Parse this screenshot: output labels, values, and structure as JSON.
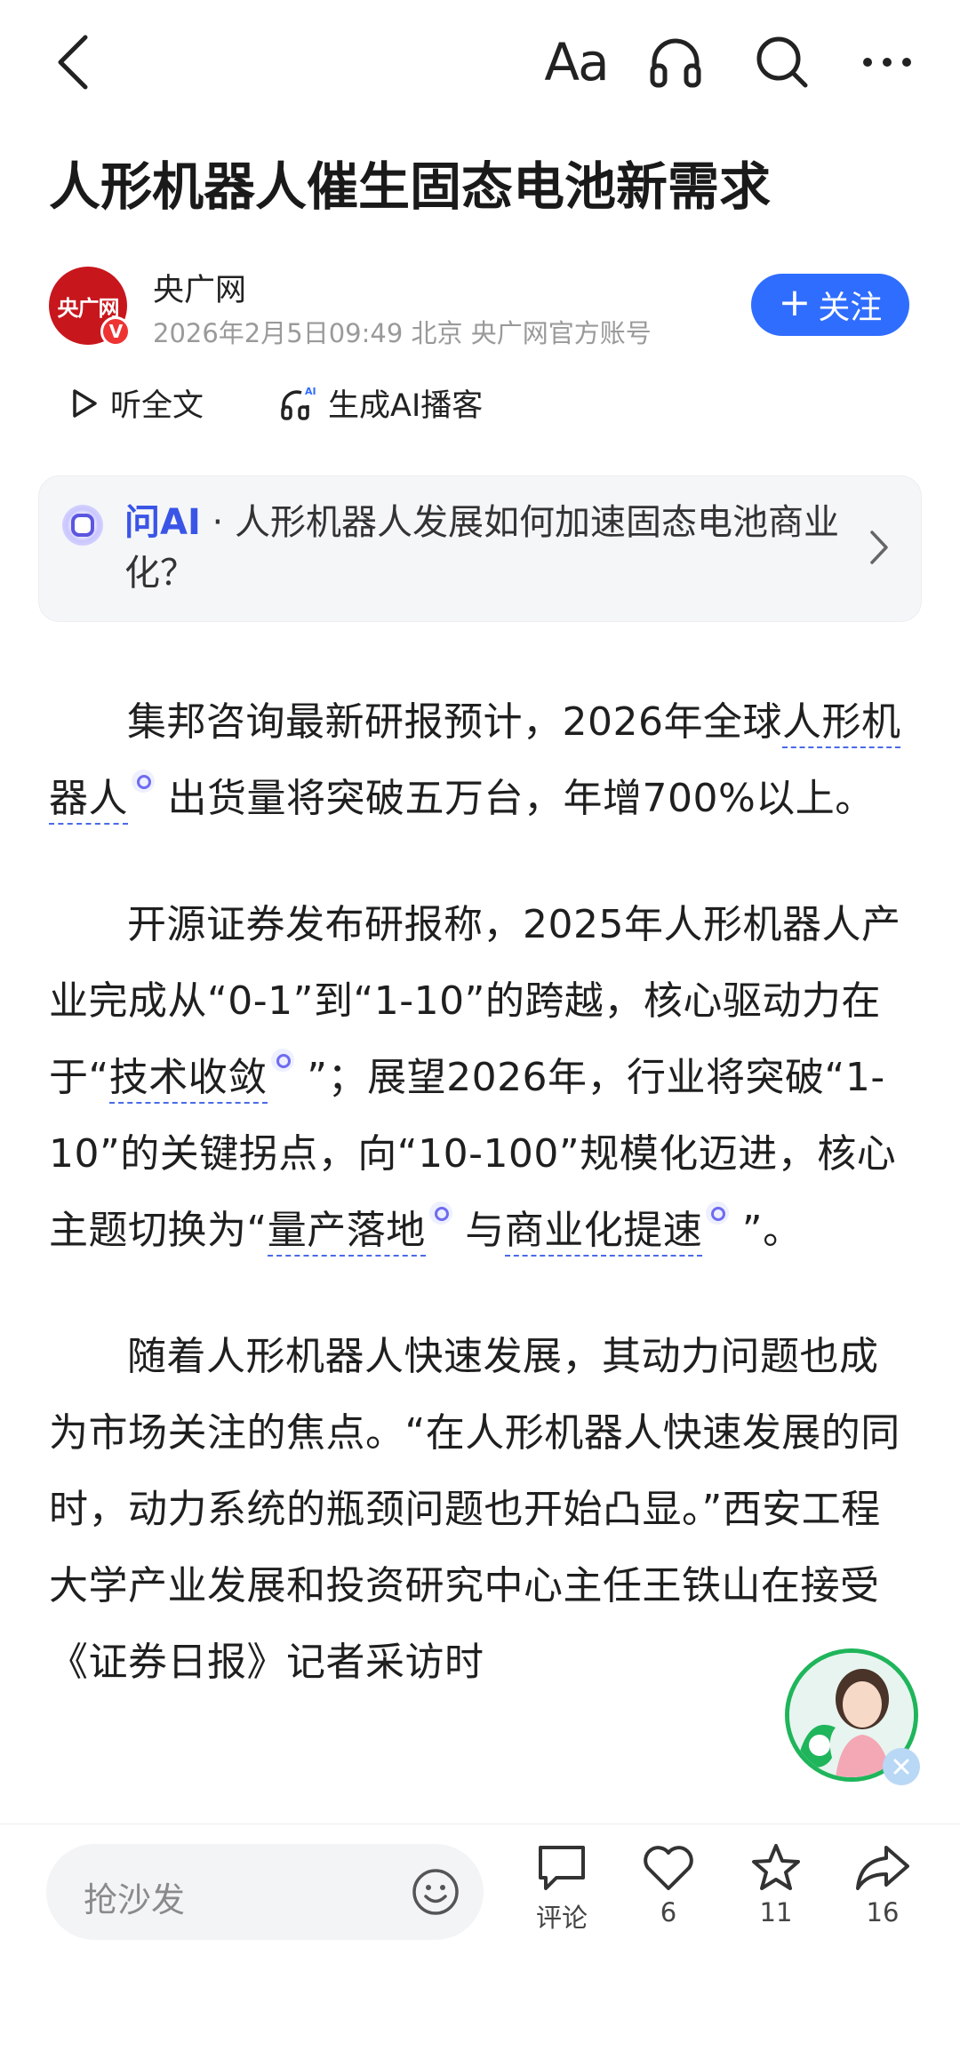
{
  "topbar": {
    "back_icon": "chevron-left-icon",
    "font_size_label": "Aa",
    "headphone_icon": "headphone-icon",
    "search_icon": "search-icon",
    "more_icon": "more-icon"
  },
  "article": {
    "title": "人形机器人催生固态电池新需求",
    "author": {
      "avatar_text": "央广网",
      "verified_badge": "V",
      "name": "央广网",
      "meta": "2026年2月5日09:49 北京 央广网官方账号",
      "follow_label": "关注",
      "follow_plus": "+"
    },
    "listen_label": "听全文",
    "podcast_label": "生成AI播客",
    "ask_ai": {
      "prefix": "问AI",
      "separator": " · ",
      "question": "人形机器人发展如何加速固态电池商业化？"
    },
    "paragraphs": {
      "p1": {
        "a": "集邦咨询最新研报预计，2026年全球",
        "kw1": "人形机器人",
        "b": " 出货量将突破五万台，年增700%以上。"
      },
      "p2": {
        "a": "开源证券发布研报称，2025年人形机器人产业完成从“0-1”到“1-10”的跨越，核心驱动力在于“",
        "kw1": "技术收敛",
        "b": " ”；展望2026年，行业将突破“1-10”的关键拐点，向“10-100”规模化迈进，核心主题切换为“",
        "kw2": "量产落地",
        "c": " 与",
        "kw3": "商业化提速",
        "d": " ”。"
      },
      "p3": {
        "text": "随着人形机器人快速发展，其动力问题也成为市场关注的焦点。“在人形机器人快速发展的同时，动力系统的瓶颈问题也开始凸显。”西安工程大学产业发展和投资研究中心主任王铁山在接受《证券日报》记者采访时"
      }
    }
  },
  "bottombar": {
    "comment_placeholder": "抢沙发",
    "emoji_icon": "smile-icon",
    "comment_label": "评论",
    "like_count": "6",
    "favorite_count": "11",
    "share_count": "16"
  },
  "colors": {
    "accent": "#2f6dff",
    "keyword_underline": "#4a6ae8",
    "brand_red": "#c8161d",
    "widget_green": "#1fb55b"
  }
}
